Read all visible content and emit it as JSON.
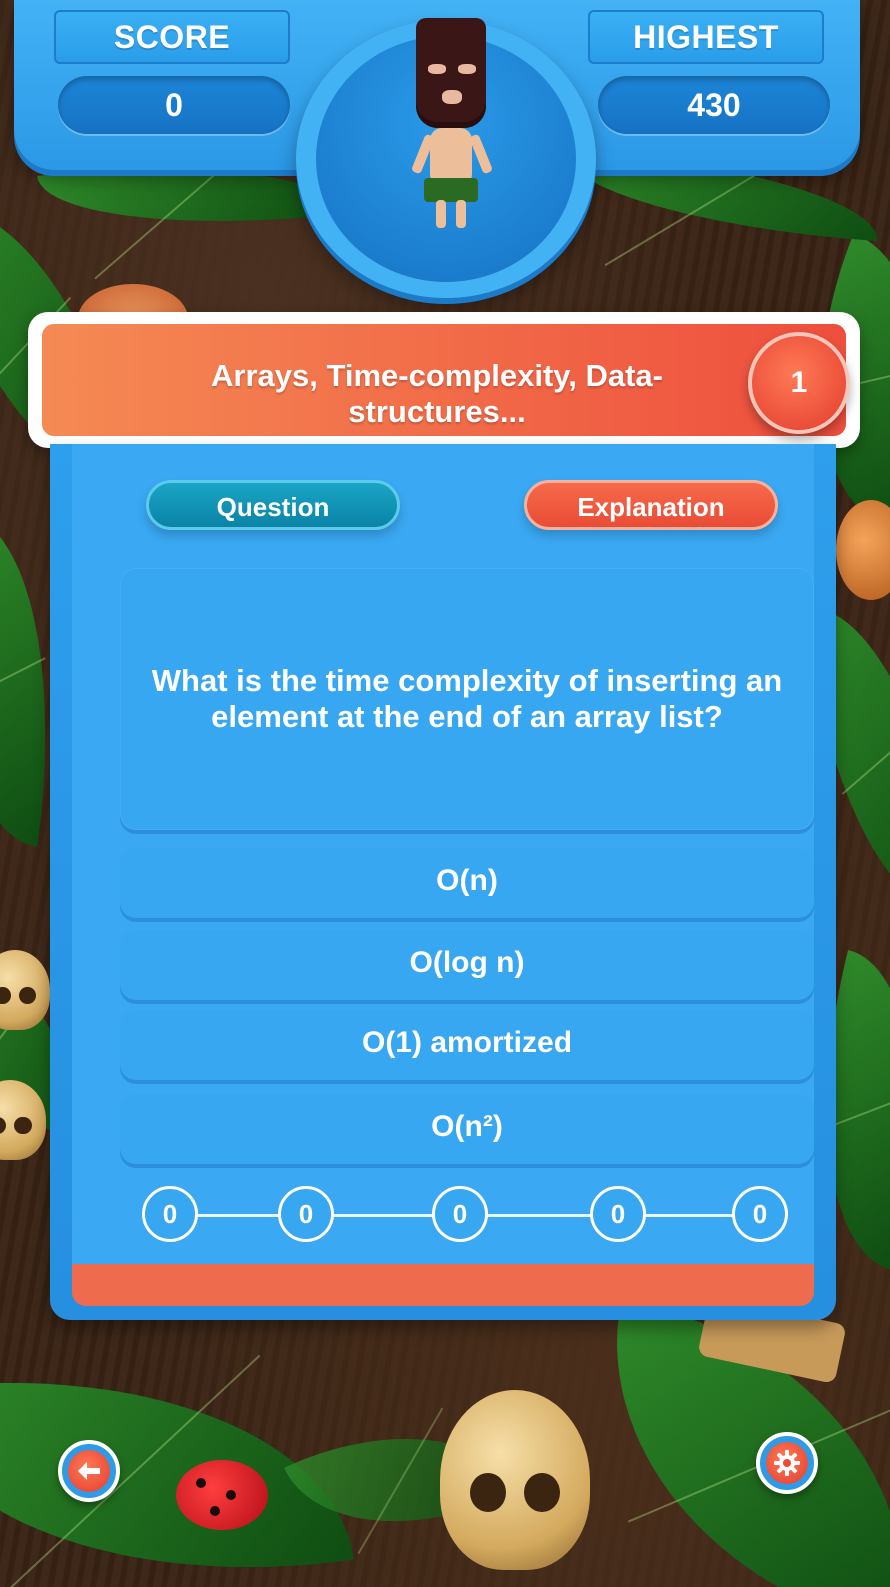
{
  "hud": {
    "score_label": "SCORE",
    "score_value": "0",
    "highest_label": "HIGHEST",
    "highest_value": "430"
  },
  "banner": {
    "topic": "Arrays, Time-complexity, Data-structures...",
    "question_number": "1"
  },
  "tabs": {
    "question": "Question",
    "explanation": "Explanation"
  },
  "question": {
    "text": "What is the time complexity of inserting an element at the end of an array list?"
  },
  "options": [
    "O(n)",
    "O(log n)",
    "O(1) amortized",
    "O(n²)"
  ],
  "progress": [
    "0",
    "0",
    "0",
    "0",
    "0"
  ],
  "icons": {
    "back": "back-arrow-icon",
    "settings": "gear-icon"
  },
  "colors": {
    "panel_blue": "#3aa8f3",
    "banner_orange": "#ee4e3d",
    "question_tab": "#0a83a6",
    "explanation_tab": "#e94c35",
    "footer_strip": "#ee6b4d"
  }
}
